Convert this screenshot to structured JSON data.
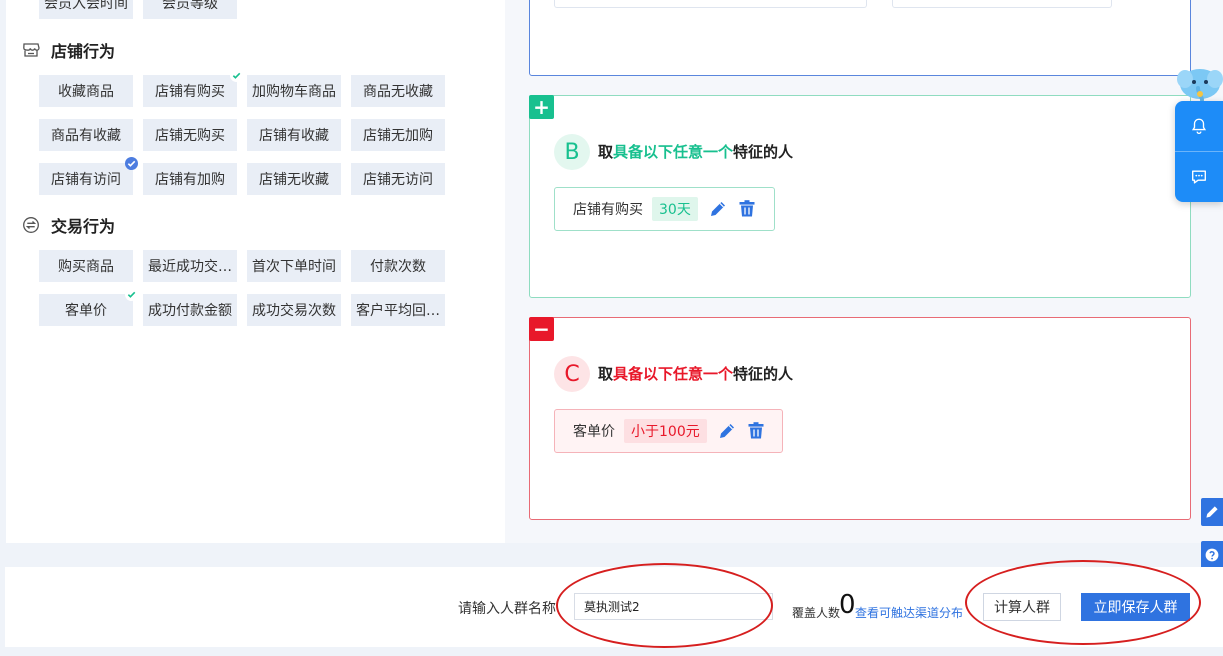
{
  "top_row": {
    "tags": [
      "会员入会时间",
      "会员等级"
    ]
  },
  "store_behavior": {
    "title": "店铺行为",
    "tags": [
      "收藏商品",
      "店铺有购买",
      "加购物车商品",
      "商品无收藏",
      "商品有收藏",
      "店铺无购买",
      "店铺有收藏",
      "店铺无加购",
      "店铺有访问",
      "店铺有加购",
      "店铺无收藏",
      "店铺无访问"
    ]
  },
  "trade_behavior": {
    "title": "交易行为",
    "tags": [
      "购买商品",
      "最近成功交…",
      "首次下单时间",
      "付款次数",
      "客单价",
      "成功付款金额",
      "成功交易次数",
      "客户平均回…"
    ]
  },
  "group_b": {
    "sign": "+",
    "letter": "B",
    "heading_prefix": "取",
    "heading_highlight": "具备以下任意一个",
    "heading_suffix": "特征的人",
    "condition": {
      "label": "店铺有购买",
      "value": "30天"
    },
    "accent": "#18c08f"
  },
  "group_c": {
    "sign": "−",
    "letter": "C",
    "heading_prefix": "取",
    "heading_highlight": "具备以下任意一个",
    "heading_suffix": "特征的人",
    "condition": {
      "label": "客单价",
      "value": "小于100元"
    },
    "accent": "#e8182a"
  },
  "bottom": {
    "name_label": "请输入人群名称",
    "name_value": "莫执测试2",
    "cover_label": "覆盖人数",
    "cover_count": "0",
    "channel_link": "查看可触达渠道分布",
    "calc_button": "计算人群",
    "save_button": "立即保存人群"
  },
  "colors": {
    "primary": "#2f73e0",
    "float": "#1d8cf8",
    "check_green": "#18c08f",
    "check_blue": "#4d7de0",
    "annotation_red": "#d61f1f"
  }
}
